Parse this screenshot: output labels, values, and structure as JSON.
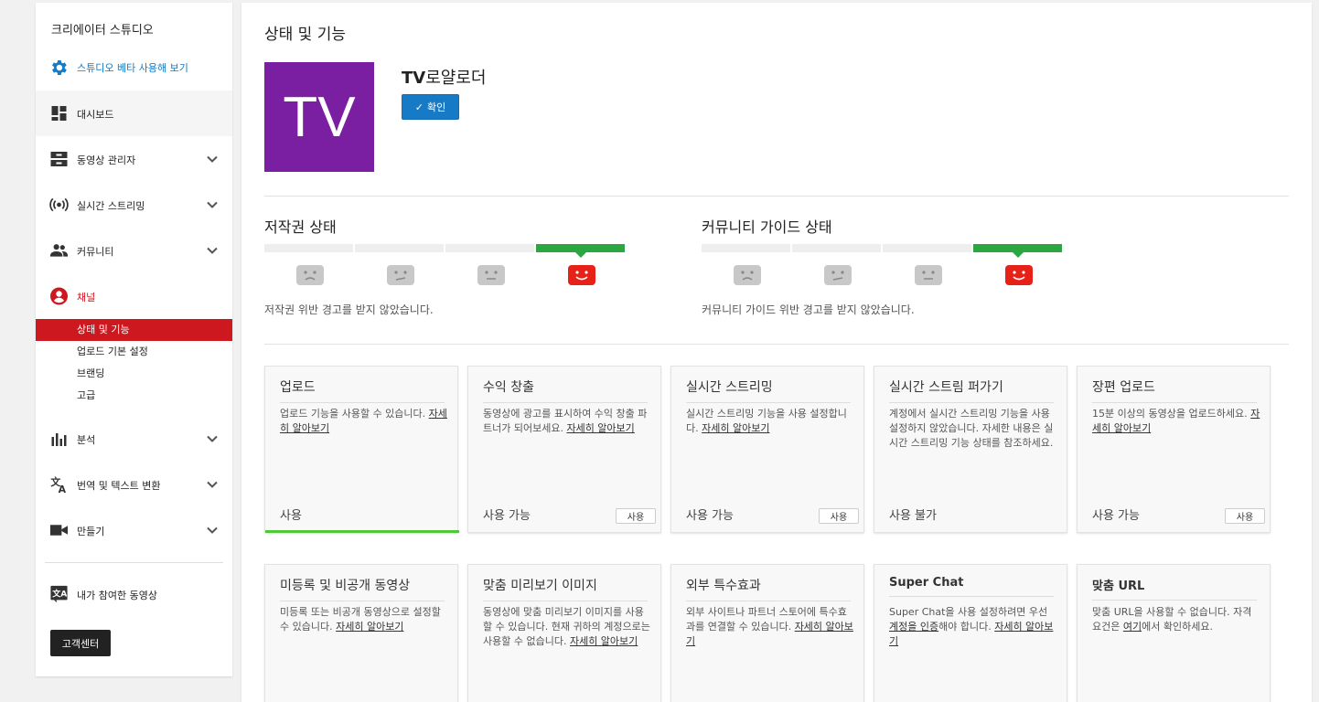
{
  "sidebar": {
    "title": "크리에이터 스튜디오",
    "beta_link": "스튜디오 베타 사용해 보기",
    "items": [
      {
        "label": "대시보드"
      },
      {
        "label": "동영상 관리자"
      },
      {
        "label": "실시간 스트리밍"
      },
      {
        "label": "커뮤니티"
      },
      {
        "label": "채널"
      },
      {
        "label": "분석"
      },
      {
        "label": "번역 및 텍스트 변환"
      },
      {
        "label": "만들기"
      },
      {
        "label": "내가 참여한 동영상"
      }
    ],
    "channel_sub": [
      {
        "label": "상태 및 기능"
      },
      {
        "label": "업로드 기본 설정"
      },
      {
        "label": "브랜딩"
      },
      {
        "label": "고급"
      }
    ],
    "help_button": "고객센터"
  },
  "main": {
    "page_title": "상태 및 기능",
    "avatar_text": "TV",
    "channel_name_bold": "TV",
    "channel_name_rest": "로얄로더",
    "verify_label": "확인",
    "copyright": {
      "title": "저작권 상태",
      "message": "저작권 위반 경고를 받지 않았습니다."
    },
    "community": {
      "title": "커뮤니티 가이드 상태",
      "message": "커뮤니티 가이드 위반 경고를 받지 않았습니다."
    },
    "features": [
      {
        "title": "업로드",
        "desc": "업로드 기능을 사용할 수 있습니다. ",
        "link": "자세히 알아보기",
        "state": "사용",
        "button": ""
      },
      {
        "title": "수익 창출",
        "desc": "동영상에 광고를 표시하여 수익 창출 파트너가 되어보세요. ",
        "link": "자세히 알아보기",
        "state": "사용 가능",
        "button": "사용"
      },
      {
        "title": "실시간 스트리밍",
        "desc": "실시간 스트리밍 기능을 사용 설정합니다. ",
        "link": "자세히 알아보기",
        "state": "사용 가능",
        "button": "사용"
      },
      {
        "title": "실시간 스트림 퍼가기",
        "desc": "계정에서 실시간 스트리밍 기능을 사용 설정하지 않았습니다. 자세한 내용은 실시간 스트리밍 기능 상태를 참조하세요.",
        "link": "",
        "state": "사용 불가",
        "button": ""
      },
      {
        "title": "장편 업로드",
        "desc": "15분 이상의 동영상을 업로드하세요. ",
        "link": "자세히 알아보기",
        "state": "사용 가능",
        "button": "사용"
      },
      {
        "title": "미등록 및 비공개 동영상",
        "desc": "미등록 또는 비공개 동영상으로 설정할 수 있습니다. ",
        "link": "자세히 알아보기",
        "state": "",
        "button": ""
      },
      {
        "title": "맞춤 미리보기 이미지",
        "desc": "동영상에 맞춤 미리보기 이미지를 사용할 수 있습니다. 현재 귀하의 계정으로는 사용할 수 없습니다. ",
        "link": "자세히 알아보기",
        "state": "",
        "button": ""
      },
      {
        "title": "외부 특수효과",
        "desc": "외부 사이트나 파트너 스토어에 특수효과를 연결할 수 있습니다. ",
        "link": "자세히 알아보기",
        "state": "",
        "button": ""
      },
      {
        "title": "Super Chat",
        "desc_a": "Super Chat을 사용 설정하려면 우선 ",
        "link_a": "계정을 인증",
        "desc_b": "해야 합니다. ",
        "link": "자세히 알아보기",
        "state": "",
        "button": ""
      },
      {
        "title": "맞춤 URL",
        "desc_a": "맞춤 URL을 사용할 수 없습니다. 자격 요건은 ",
        "link_a": "여기",
        "desc_b": "에서 확인하세요.",
        "state": "",
        "button": ""
      }
    ]
  },
  "colors": {
    "accent_red": "#cc181e",
    "accent_blue": "#167ac6",
    "green": "#2ba640",
    "avatar_purple": "#7b1fa2"
  }
}
